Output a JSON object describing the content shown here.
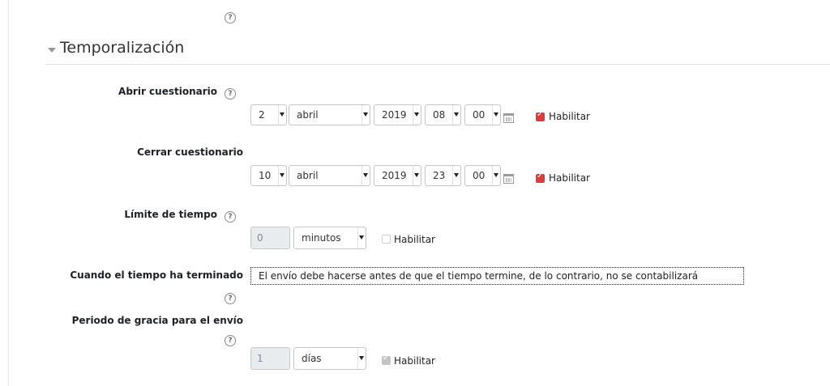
{
  "help_glyph": "?",
  "section": {
    "title": "Temporalización"
  },
  "open_quiz": {
    "label": "Abrir cuestionario",
    "day": "2",
    "month": "abril",
    "year": "2019",
    "hour": "08",
    "minute": "00",
    "enable_label": "Habilitar",
    "enabled": true
  },
  "close_quiz": {
    "label": "Cerrar cuestionario",
    "day": "10",
    "month": "abril",
    "year": "2019",
    "hour": "23",
    "minute": "00",
    "enable_label": "Habilitar",
    "enabled": true
  },
  "time_limit": {
    "label": "Límite de tiempo",
    "value": "0",
    "unit": "minutos",
    "enable_label": "Habilitar",
    "enabled": false
  },
  "when_time_expires": {
    "label": "Cuando el tiempo ha terminado",
    "value": "El envío debe hacerse antes de que el tiempo termine, de lo contrario, no se contabilizará"
  },
  "grace_period": {
    "label": "Periodo de gracia para el envío",
    "value": "1",
    "unit": "días",
    "enable_label": "Habilitar",
    "enabled": true,
    "disabled": true
  },
  "colors": {
    "checkbox_on": "#e13a3a",
    "checkbox_disabled": "#c3c3c3"
  }
}
